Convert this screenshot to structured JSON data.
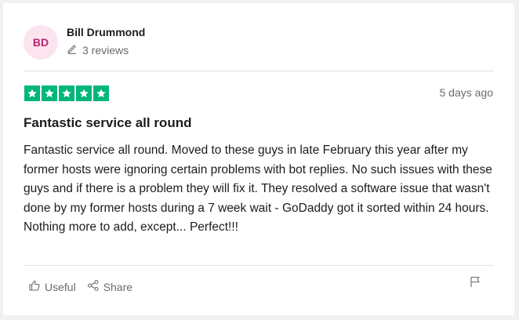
{
  "reviewer": {
    "initials": "BD",
    "name": "Bill Drummond",
    "reviews": "3 reviews"
  },
  "review": {
    "rating": 5,
    "rating_max": 5,
    "date": "5 days ago",
    "title": "Fantastic service all round",
    "body_lines": [
      "Fantastic service all round. Moved to these guys in late February this year after my former hosts were ignoring certain problems with bot replies. No such issues with these guys and if there is a problem they will fix it. They resolved a software issue that wasn't done by my former hosts during a 7 week wait - GoDaddy got it sorted within 24 hours.",
      "Nothing more to add, except... Perfect!!!"
    ]
  },
  "actions": {
    "useful_label": "Useful",
    "share_label": "Share"
  },
  "colors": {
    "star_green": "#00b67a",
    "avatar_bg": "#fbe4ef",
    "avatar_text": "#b8266e"
  }
}
